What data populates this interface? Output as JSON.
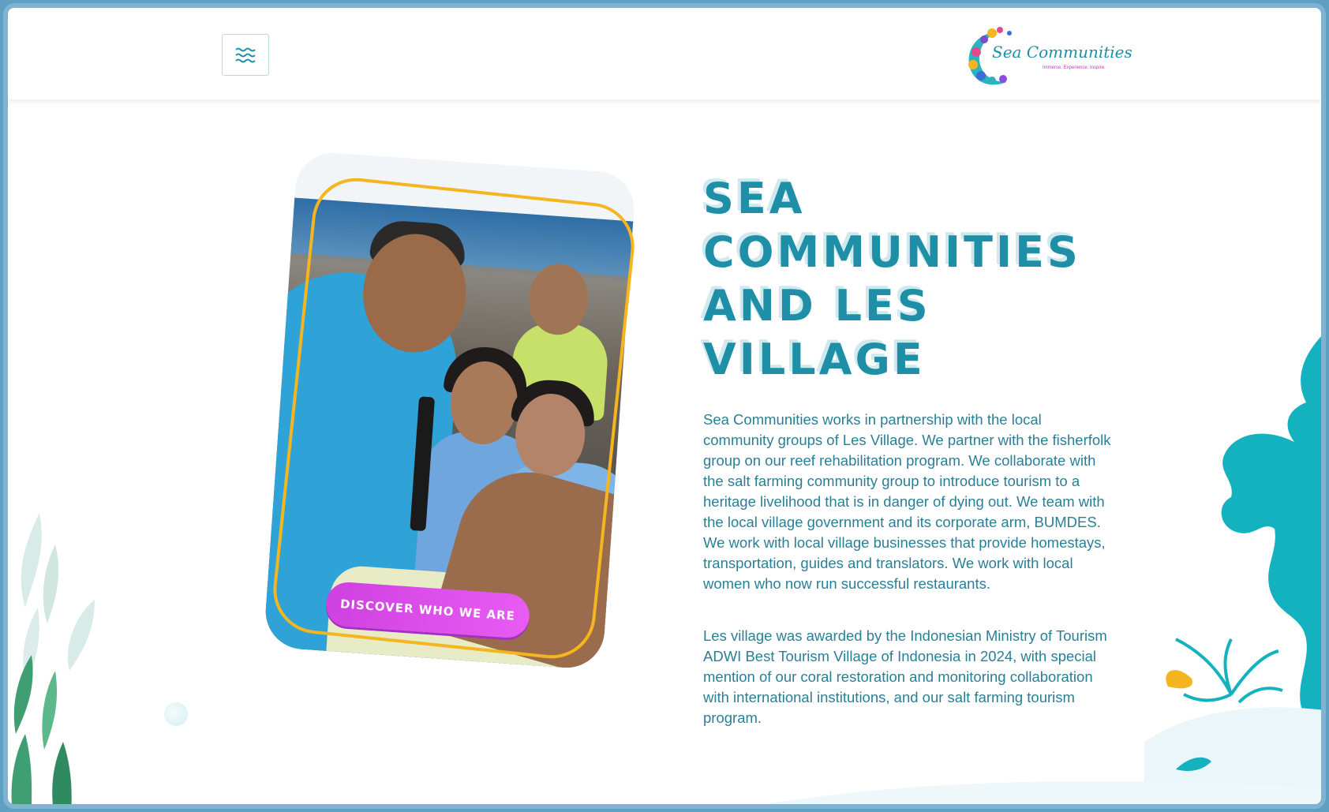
{
  "header": {
    "menu_icon": "waves-menu-icon",
    "logo": {
      "name": "Sea Communities",
      "tagline": "Immerse. Experience. Inspire."
    }
  },
  "hero": {
    "image_alt": "Fisherman weighing a catch with village students",
    "cta_label": "Discover who we are",
    "title": "SEA COMMUNITIES AND LES VILLAGE",
    "paragraphs": [
      "Sea Communities works in partnership with the local community groups of Les Village. We partner with the fisherfolk group on our reef rehabilitation program. We collaborate with the salt farming community group to introduce tourism to a heritage livelihood that is in danger of dying out. We team with the local village government and its corporate arm, BUMDES. We work with local village businesses that provide homestays, transportation, guides and translators. We work with local women who now run successful restaurants.",
      "Les village was awarded by the Indonesian Ministry of Tourism ADWI Best Tourism Village of Indonesia in 2024, with special mention of our coral restoration and monitoring collaboration with international institutions, and our salt farming tourism program."
    ]
  },
  "colors": {
    "accent": "#1e8fa6",
    "cta": "#e059f0",
    "outline": "#f5b51e",
    "coral": "#12b2be"
  }
}
